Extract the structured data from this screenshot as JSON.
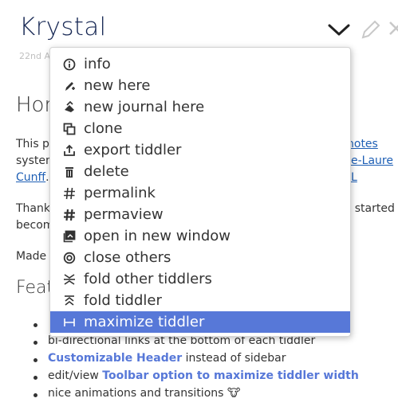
{
  "tiddler": {
    "title": "Krystal",
    "subtitle": "22nd A",
    "toolbar": {
      "more_icon": "chevron-down-icon",
      "edit_icon": "pencil-icon",
      "close_icon": "close-icon"
    },
    "home_heading": "Hon",
    "para1": {
      "start": "This pl",
      "line2_start": "system",
      "link_notes": "notes",
      "link_author": "e-Laure L",
      "link_author_2": "Cunff",
      "link_author_2_tail": "."
    },
    "para2": {
      "start": "Thanks",
      "end": "y started",
      "line2": "becom"
    },
    "para3": "Made",
    "features_heading": "Featu",
    "features": [
      {
        "text": ""
      },
      {
        "text": "bi-directional links at the bottom of each tiddler"
      },
      {
        "link": "Customizable Header",
        "text": " instead of sidebar"
      },
      {
        "prefix": "edit/view ",
        "link": "Toolbar option to maximize tiddler width"
      },
      {
        "text": "nice animations and transitions ",
        "emoji": "🐮"
      }
    ]
  },
  "menu": {
    "items": [
      {
        "label": "info",
        "icon": "info-icon"
      },
      {
        "label": "new here",
        "icon": "new-here-icon"
      },
      {
        "label": "new journal here",
        "icon": "new-journal-icon"
      },
      {
        "label": "clone",
        "icon": "clone-icon"
      },
      {
        "label": "export tiddler",
        "icon": "export-icon"
      },
      {
        "label": "delete",
        "icon": "trash-icon"
      },
      {
        "label": "permalink",
        "icon": "permalink-icon"
      },
      {
        "label": "permaview",
        "icon": "permaview-icon"
      },
      {
        "label": "open in new window",
        "icon": "open-window-icon"
      },
      {
        "label": "close others",
        "icon": "close-others-icon"
      },
      {
        "label": "fold other tiddlers",
        "icon": "fold-others-icon"
      },
      {
        "label": "fold tiddler",
        "icon": "fold-icon"
      },
      {
        "label": "maximize tiddler",
        "icon": "maximize-icon",
        "active": true
      }
    ],
    "active_color": "#5778d8"
  }
}
